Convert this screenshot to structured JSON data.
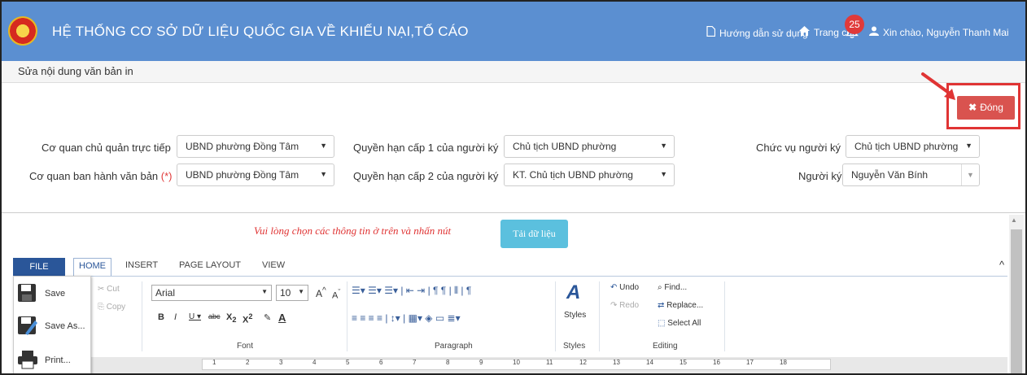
{
  "header": {
    "title": "HỆ THỐNG CƠ SỞ DỮ LIỆU QUỐC GIA VỀ KHIẾU NẠI,TỐ CÁO",
    "nav_home": "Trang chủ",
    "nav_guide": "Hướng dẫn sử dụng",
    "notification_count": "25",
    "user_greeting": "Xin chào, Nguyễn Thanh Mai",
    "brand_color": "#5b8fd1"
  },
  "subheader": {
    "title": "Sửa nội dung văn bản in"
  },
  "actions": {
    "close_label": "Đóng",
    "close_color": "#d9534f"
  },
  "form": {
    "row1": {
      "agency_label": "Cơ quan chủ quản trực tiếp",
      "agency_value": "UBND phường Đồng Tâm",
      "authority1_label": "Quyền hạn cấp 1 của người ký",
      "authority1_value": "Chủ tịch UBND phường",
      "position_label": "Chức vụ người ký",
      "position_value": "Chủ tịch UBND phường"
    },
    "row2": {
      "issuer_label": "Cơ quan ban hành văn bản",
      "issuer_required": "(*)",
      "issuer_value": "UBND phường Đồng Tâm",
      "authority2_label": "Quyền hạn cấp 2 của người ký",
      "authority2_value": "KT. Chủ tịch UBND phường",
      "signer_label": "Người ký",
      "signer_value": "Nguyễn Văn Bính"
    }
  },
  "hint": "Vui lòng chọn các thông tin ở trên và nhấn nút",
  "load_button": "Tải dữ liệu",
  "ribbon": {
    "tabs": {
      "file": "FILE",
      "home": "HOME",
      "insert": "INSERT",
      "page_layout": "PAGE LAYOUT",
      "view": "VIEW"
    },
    "file_menu": {
      "save": "Save",
      "save_as": "Save As...",
      "print": "Print..."
    },
    "clipboard": {
      "cut": "Cut",
      "copy": "Copy"
    },
    "font": {
      "family": "Arial",
      "size": "10",
      "group": "Font"
    },
    "paragraph": {
      "group": "Paragraph"
    },
    "styles": {
      "label": "Styles",
      "group": "Styles"
    },
    "editing": {
      "undo": "Undo",
      "redo": "Redo",
      "find": "Find...",
      "replace": "Replace...",
      "select_all": "Select All",
      "group": "Editing"
    }
  },
  "ruler": {
    "ticks": [
      "1",
      "2",
      "3",
      "4",
      "5",
      "6",
      "7",
      "8",
      "9",
      "10",
      "11",
      "12",
      "13",
      "14",
      "15",
      "16",
      "17",
      "18"
    ]
  }
}
